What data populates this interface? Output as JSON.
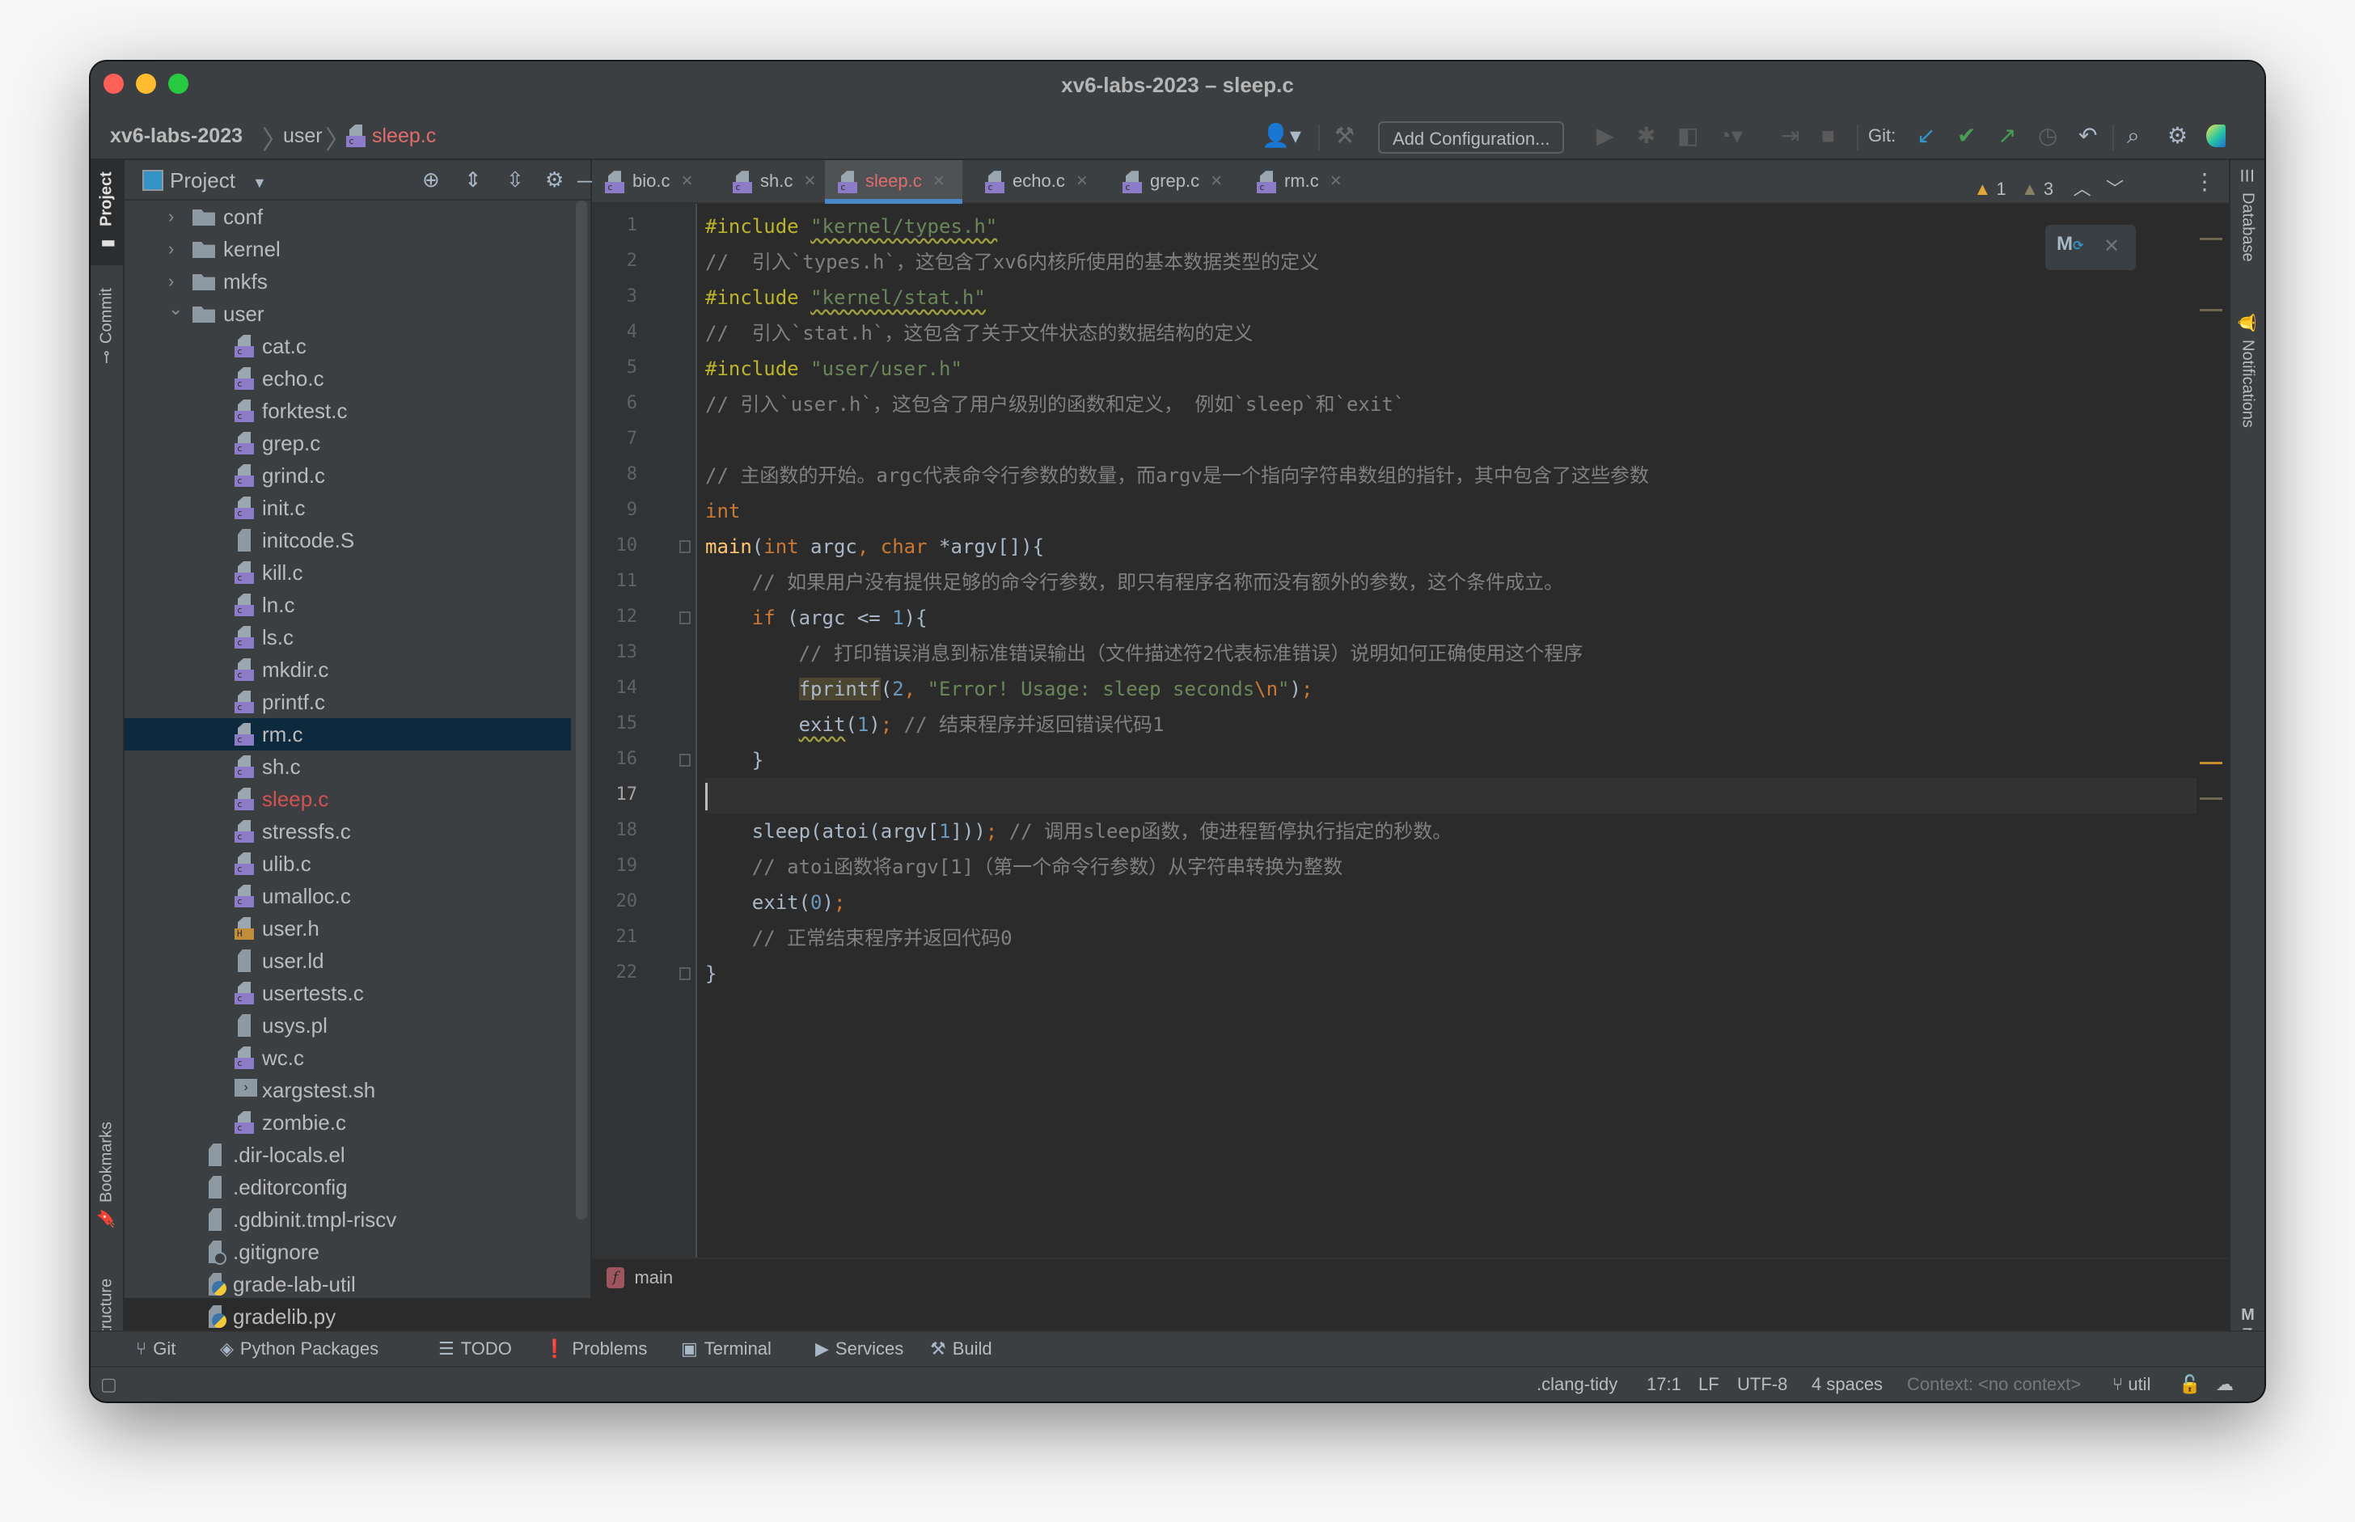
{
  "window": {
    "title": "xv6-labs-2023 – sleep.c",
    "traffic_lights": {
      "close": "#fe5f57",
      "minimize": "#febc2e",
      "zoom": "#28c840"
    }
  },
  "breadcrumb": {
    "project": "xv6-labs-2023",
    "folder": "user",
    "file": "sleep.c"
  },
  "toolbar": {
    "add_configuration": "Add Configuration...",
    "git_label": "Git:",
    "icons": [
      "user-icon",
      "hammer-icon",
      "run-icon",
      "debug-icon",
      "coverage-icon",
      "profile-icon",
      "attach-icon",
      "stop-icon",
      "git-update-icon",
      "git-commit-icon",
      "git-push-icon",
      "history-icon",
      "rollback-icon",
      "search-icon",
      "settings-icon",
      "jetbrains-logo-icon"
    ]
  },
  "left_strip": {
    "project": "Project",
    "commit": "Commit",
    "bookmarks": "Bookmarks",
    "structure": "Structure"
  },
  "right_strip": {
    "database": "Database",
    "notifications": "Notifications",
    "make": "make"
  },
  "project_panel": {
    "title": "Project",
    "tree": [
      {
        "name": "conf",
        "type": "folder",
        "level": 1,
        "expanded": false
      },
      {
        "name": "kernel",
        "type": "folder",
        "level": 1,
        "expanded": false
      },
      {
        "name": "mkfs",
        "type": "folder",
        "level": 1,
        "expanded": false
      },
      {
        "name": "user",
        "type": "folder",
        "level": 1,
        "expanded": true
      },
      {
        "name": "cat.c",
        "type": "c",
        "level": 2
      },
      {
        "name": "echo.c",
        "type": "c",
        "level": 2
      },
      {
        "name": "forktest.c",
        "type": "c",
        "level": 2
      },
      {
        "name": "grep.c",
        "type": "c",
        "level": 2
      },
      {
        "name": "grind.c",
        "type": "c",
        "level": 2
      },
      {
        "name": "init.c",
        "type": "c",
        "level": 2
      },
      {
        "name": "initcode.S",
        "type": "text",
        "level": 2
      },
      {
        "name": "kill.c",
        "type": "c",
        "level": 2
      },
      {
        "name": "ln.c",
        "type": "c",
        "level": 2
      },
      {
        "name": "ls.c",
        "type": "c",
        "level": 2
      },
      {
        "name": "mkdir.c",
        "type": "c",
        "level": 2
      },
      {
        "name": "printf.c",
        "type": "c",
        "level": 2
      },
      {
        "name": "rm.c",
        "type": "c",
        "level": 2,
        "selected": true
      },
      {
        "name": "sh.c",
        "type": "c",
        "level": 2
      },
      {
        "name": "sleep.c",
        "type": "c",
        "level": 2,
        "modified": true
      },
      {
        "name": "stressfs.c",
        "type": "c",
        "level": 2
      },
      {
        "name": "ulib.c",
        "type": "c",
        "level": 2
      },
      {
        "name": "umalloc.c",
        "type": "c",
        "level": 2
      },
      {
        "name": "user.h",
        "type": "h",
        "level": 2
      },
      {
        "name": "user.ld",
        "type": "text",
        "level": 2
      },
      {
        "name": "usertests.c",
        "type": "c",
        "level": 2
      },
      {
        "name": "usys.pl",
        "type": "text",
        "level": 2
      },
      {
        "name": "wc.c",
        "type": "c",
        "level": 2
      },
      {
        "name": "xargstest.sh",
        "type": "shell",
        "level": 2
      },
      {
        "name": "zombie.c",
        "type": "c",
        "level": 2
      },
      {
        "name": ".dir-locals.el",
        "type": "text",
        "level": 1
      },
      {
        "name": ".editorconfig",
        "type": "text",
        "level": 1
      },
      {
        "name": ".gdbinit.tmpl-riscv",
        "type": "text",
        "level": 1
      },
      {
        "name": ".gitignore",
        "type": "ignore",
        "level": 1
      },
      {
        "name": "grade-lab-util",
        "type": "python",
        "level": 1
      },
      {
        "name": "gradelib.py",
        "type": "python",
        "level": 1
      }
    ]
  },
  "tabs": [
    {
      "label": "bio.c",
      "active": false
    },
    {
      "label": "sh.c",
      "active": false
    },
    {
      "label": "sleep.c",
      "active": true
    },
    {
      "label": "echo.c",
      "active": false
    },
    {
      "label": "grep.c",
      "active": false
    },
    {
      "label": "rm.c",
      "active": false
    }
  ],
  "inspections": {
    "warnings": "1",
    "weak_warnings": "3"
  },
  "code": {
    "current_line": 17,
    "lines": [
      {
        "n": "1",
        "segs": [
          [
            "pp",
            "#include "
          ],
          [
            "str squig",
            "\"kernel/types.h\""
          ]
        ]
      },
      {
        "n": "2",
        "segs": [
          [
            "cm",
            "//  引入`types.h`，这包含了xv6内核所使用的基本数据类型的定义"
          ]
        ]
      },
      {
        "n": "3",
        "segs": [
          [
            "pp",
            "#include "
          ],
          [
            "str squig",
            "\"kernel/stat.h\""
          ]
        ]
      },
      {
        "n": "4",
        "segs": [
          [
            "cm",
            "//  引入`stat.h`，这包含了关于文件状态的数据结构的定义"
          ]
        ]
      },
      {
        "n": "5",
        "segs": [
          [
            "pp",
            "#include "
          ],
          [
            "str",
            "\"user/user.h\""
          ]
        ]
      },
      {
        "n": "6",
        "segs": [
          [
            "cm",
            "// 引入`user.h`，这包含了用户级别的函数和定义， 例如`sleep`和`exit`"
          ]
        ]
      },
      {
        "n": "7",
        "segs": []
      },
      {
        "n": "8",
        "segs": [
          [
            "cm",
            "// 主函数的开始。argc代表命令行参数的数量，而argv是一个指向字符串数组的指针，其中包含了这些参数"
          ]
        ]
      },
      {
        "n": "9",
        "segs": [
          [
            "kw",
            "int"
          ]
        ]
      },
      {
        "n": "10",
        "segs": [
          [
            "fn",
            "main"
          ],
          [
            "",
            "("
          ],
          [
            "kw",
            "int "
          ],
          [
            "",
            "argc"
          ],
          [
            "kw",
            ", char "
          ],
          [
            "",
            "*argv[]){"
          ]
        ]
      },
      {
        "n": "11",
        "segs": [
          [
            "",
            "    "
          ],
          [
            "cm",
            "// 如果用户没有提供足够的命令行参数，即只有程序名称而没有额外的参数，这个条件成立。"
          ]
        ]
      },
      {
        "n": "12",
        "segs": [
          [
            "",
            "    "
          ],
          [
            "kw",
            "if "
          ],
          [
            "",
            "(argc <= "
          ],
          [
            "num",
            "1"
          ],
          [
            "",
            "){"
          ]
        ]
      },
      {
        "n": "13",
        "segs": [
          [
            "",
            "        "
          ],
          [
            "cm",
            "// 打印错误消息到标准错误输出（文件描述符2代表标准错误）说明如何正确使用这个程序"
          ]
        ]
      },
      {
        "n": "14",
        "segs": [
          [
            "",
            "        "
          ],
          [
            "hl",
            "fprintf"
          ],
          [
            "",
            "("
          ],
          [
            "num",
            "2"
          ],
          [
            "kw",
            ", "
          ],
          [
            "str",
            "\"Error! Usage: sleep seconds"
          ],
          [
            "esc",
            "\\n"
          ],
          [
            "str",
            "\""
          ],
          [
            "",
            ")"
          ],
          [
            "kw",
            ";"
          ]
        ]
      },
      {
        "n": "15",
        "segs": [
          [
            "",
            "        "
          ],
          [
            "squig",
            "exit"
          ],
          [
            "",
            "("
          ],
          [
            "num",
            "1"
          ],
          [
            "",
            ")"
          ],
          [
            "kw",
            "; "
          ],
          [
            "cm",
            "// 结束程序并返回错误代码1"
          ]
        ]
      },
      {
        "n": "16",
        "segs": [
          [
            "",
            "    }"
          ]
        ]
      },
      {
        "n": "17",
        "segs": []
      },
      {
        "n": "18",
        "segs": [
          [
            "",
            "    sleep(atoi(argv["
          ],
          [
            "num",
            "1"
          ],
          [
            "",
            "]))"
          ],
          [
            "kw",
            "; "
          ],
          [
            "cm",
            "// 调用sleep函数，使进程暂停执行指定的秒数。"
          ]
        ]
      },
      {
        "n": "19",
        "segs": [
          [
            "",
            "    "
          ],
          [
            "cm",
            "// atoi函数将argv[1]（第一个命令行参数）从字符串转换为整数"
          ]
        ]
      },
      {
        "n": "20",
        "segs": [
          [
            "",
            "    exit("
          ],
          [
            "num",
            "0"
          ],
          [
            "",
            ")"
          ],
          [
            "kw",
            ";"
          ]
        ]
      },
      {
        "n": "21",
        "segs": [
          [
            "",
            "    "
          ],
          [
            "cm",
            "// 正常结束程序并返回代码0"
          ]
        ]
      },
      {
        "n": "22",
        "segs": [
          [
            "",
            "}"
          ]
        ]
      }
    ]
  },
  "editor_breadcrumb": {
    "badge": "f",
    "function": "main"
  },
  "bottom_tools": [
    {
      "icon": "git-branch-icon",
      "glyph": "⑂",
      "label": "Git"
    },
    {
      "icon": "python-packages-icon",
      "glyph": "◈",
      "label": "Python Packages"
    },
    {
      "icon": "todo-icon",
      "glyph": "☰",
      "label": "TODO"
    },
    {
      "icon": "problems-icon",
      "glyph": "❗",
      "label": "Problems"
    },
    {
      "icon": "terminal-icon",
      "glyph": "▣",
      "label": "Terminal"
    },
    {
      "icon": "services-icon",
      "glyph": "▶",
      "label": "Services"
    },
    {
      "icon": "build-icon",
      "glyph": "⚒",
      "label": "Build"
    }
  ],
  "status": {
    "linter": ".clang-tidy",
    "position": "17:1",
    "line_sep": "LF",
    "encoding": "UTF-8",
    "indent": "4 spaces",
    "context": "Context: <no context>",
    "branch": "util"
  }
}
